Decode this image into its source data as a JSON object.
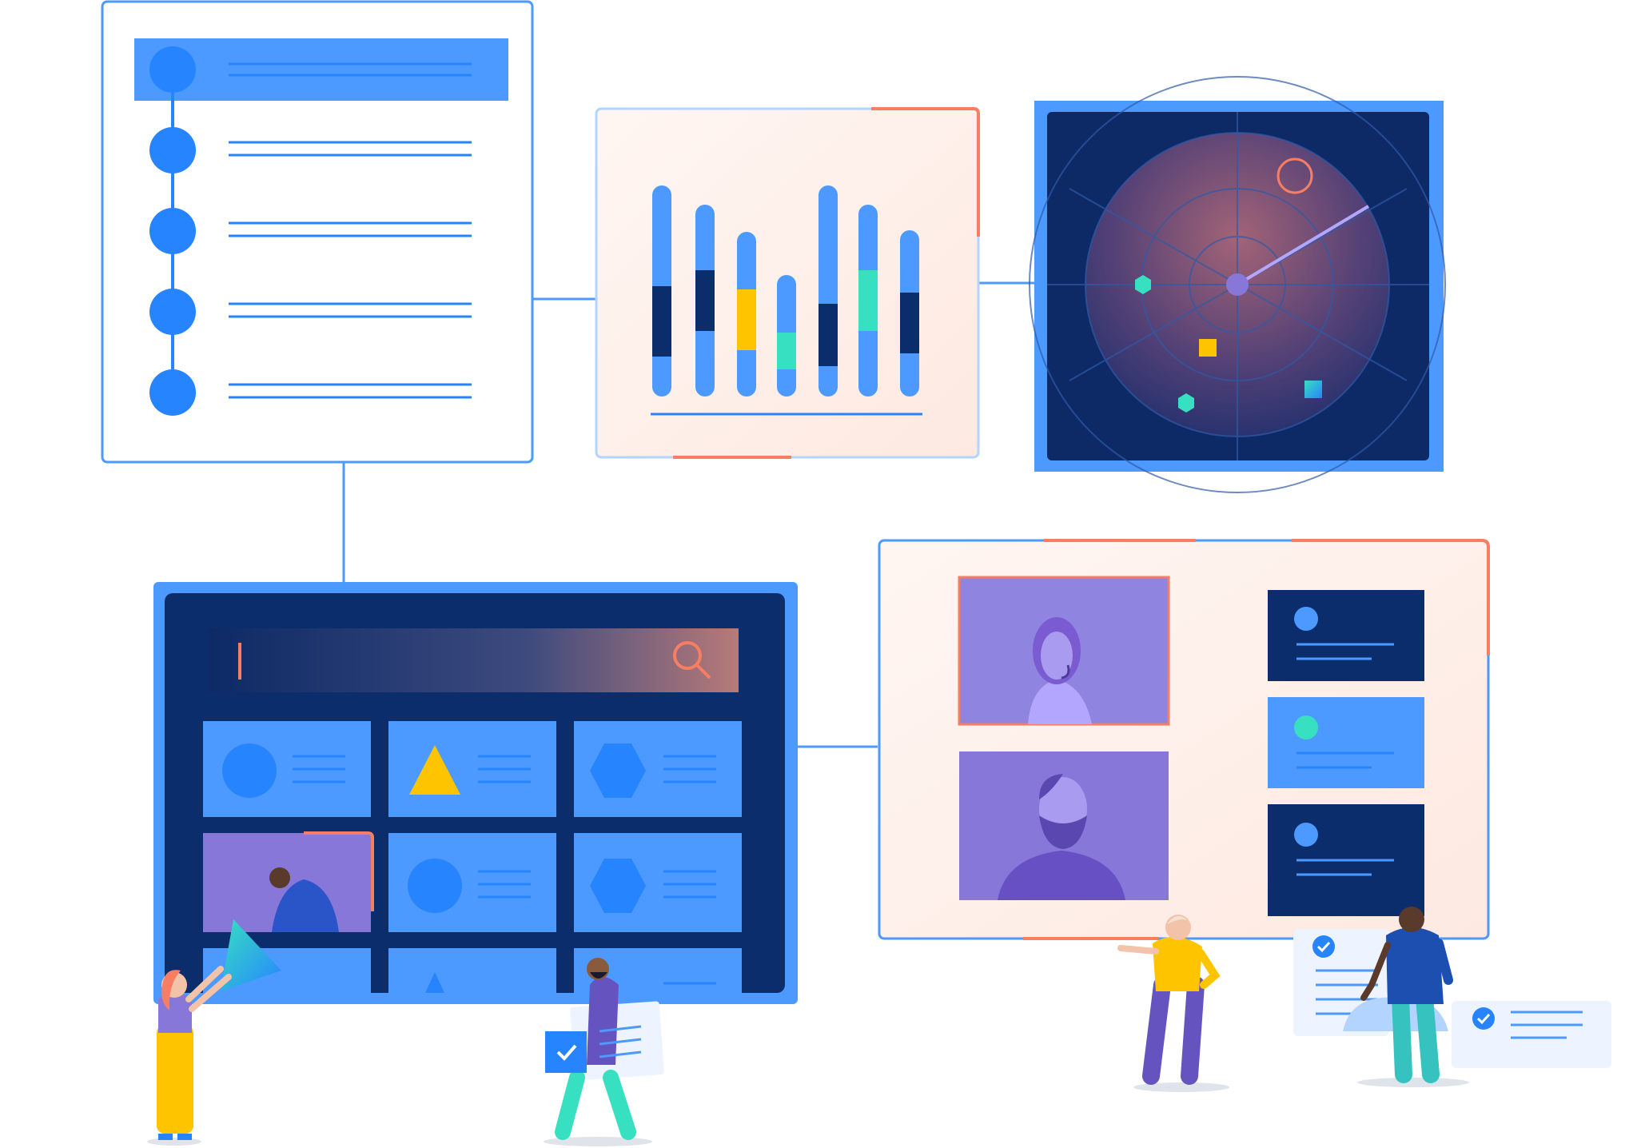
{
  "colors": {
    "primary_blue": "#4c9aff",
    "mid_blue": "#2684ff",
    "navy": "#0b2d6b",
    "deep_navy": "#0a1f4d",
    "coral": "#f77e63",
    "teal": "#36e0c0",
    "yellow": "#ffc400",
    "purple": "#8777d9",
    "panel_peach": "#fff1ea"
  },
  "panels": {
    "list_panel": {
      "rows": 5
    },
    "chart_panel": {
      "bars": 7
    },
    "radar_panel": {
      "blips": [
        "teal-hexagon",
        "yellow-square",
        "teal-hexagon",
        "teal-square"
      ]
    },
    "search_panel": {
      "query": "",
      "tiles": [
        "circle",
        "triangle",
        "hexagon",
        "video",
        "circle",
        "hexagon"
      ]
    },
    "video_panel": {
      "participants": 2,
      "cards": 3
    }
  },
  "icons": [
    "search-icon",
    "check-icon",
    "user-headset-icon",
    "user-beard-icon"
  ]
}
